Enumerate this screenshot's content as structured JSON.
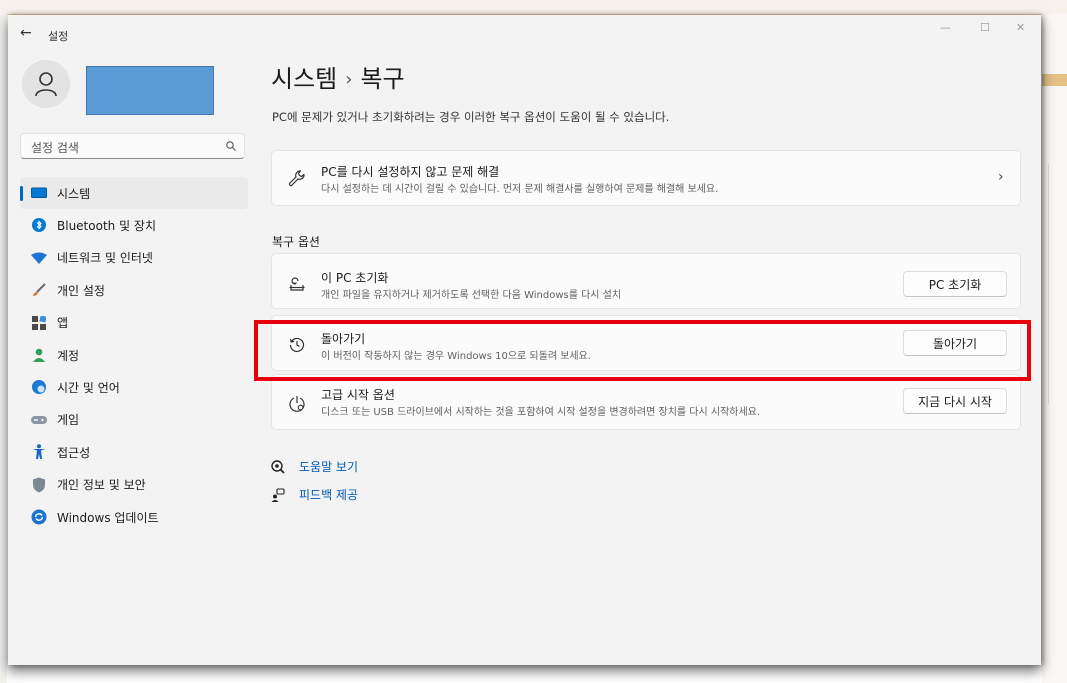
{
  "window": {
    "title": "설정",
    "controls": [
      "minimize-icon",
      "maximize-icon",
      "close-icon"
    ]
  },
  "search": {
    "placeholder": "설정 검색"
  },
  "sidebar": {
    "items": [
      {
        "label": "시스템",
        "icon": "monitor-icon",
        "active": true
      },
      {
        "label": "Bluetooth 및 장치",
        "icon": "bluetooth-icon"
      },
      {
        "label": "네트워크 및 인터넷",
        "icon": "wifi-icon"
      },
      {
        "label": "개인 설정",
        "icon": "brush-icon"
      },
      {
        "label": "앱",
        "icon": "apps-icon"
      },
      {
        "label": "계정",
        "icon": "person-icon"
      },
      {
        "label": "시간 및 언어",
        "icon": "globe-clock-icon"
      },
      {
        "label": "게임",
        "icon": "gamepad-icon"
      },
      {
        "label": "접근성",
        "icon": "accessibility-icon"
      },
      {
        "label": "개인 정보 및 보안",
        "icon": "shield-icon"
      },
      {
        "label": "Windows 업데이트",
        "icon": "update-icon"
      }
    ]
  },
  "header": {
    "breadcrumb_parent": "시스템",
    "breadcrumb_sep": "›",
    "breadcrumb_current": "복구",
    "description": "PC에 문제가 있거나 초기화하려는 경우 이러한 복구 옵션이 도움이 될 수 있습니다."
  },
  "troubleshoot_card": {
    "title": "PC를 다시 설정하지 않고 문제 해결",
    "subtitle": "다시 설정하는 데 시간이 걸릴 수 있습니다. 먼저 문제 해결사를 실행하여 문제를 해결해 보세요.",
    "icon": "wrench-icon",
    "chevron": "›"
  },
  "recovery_section": {
    "title": "복구 옵션",
    "options": [
      {
        "title": "이 PC 초기화",
        "subtitle": "개인 파일을 유지하거나 제거하도록 선택한 다음 Windows를 다시 설치",
        "button": "PC 초기화",
        "icon": "reset-pc-icon"
      },
      {
        "title": "돌아가기",
        "subtitle": "이 버전이 작동하지 않는 경우 Windows 10으로 되돌려 보세요.",
        "button": "돌아가기",
        "icon": "history-icon"
      },
      {
        "title": "고급 시작 옵션",
        "subtitle": "디스크 또는 USB 드라이브에서 시작하는 것을 포함하여 시작 설정을 변경하려면 장치를 다시 시작하세요.",
        "button": "지금 다시 시작",
        "icon": "advanced-startup-icon"
      }
    ]
  },
  "links": {
    "help": "도움말 보기",
    "feedback": "피드백 제공"
  },
  "colors": {
    "accent": "#0067c0",
    "link": "#0058b0",
    "highlight_box": "#e8000b",
    "redaction": "#5b9bd5"
  }
}
